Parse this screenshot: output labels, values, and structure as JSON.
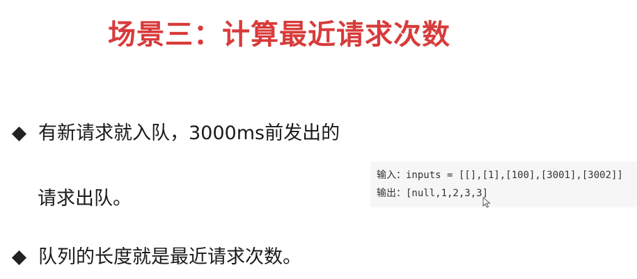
{
  "slide": {
    "title": "场景三：计算最近请求次数"
  },
  "bullets": [
    {
      "icon": "diamond-bullet-icon",
      "line1": "有新请求就入队，3000ms前发出的",
      "line2": "请求出队。"
    },
    {
      "icon": "diamond-bullet-icon",
      "line1": "队列的长度就是最近请求次数。"
    }
  ],
  "code_example": {
    "input_line": "输入：inputs = [[],[1],[100],[3001],[3002]]",
    "output_line": "输出：[null,1,2,3,3]"
  },
  "colors": {
    "title": "#d83b3b",
    "text": "#1a1a1a",
    "code_background": "#f6f6f6"
  },
  "icons": {
    "mouse_cursor": "mouse-cursor-icon"
  }
}
